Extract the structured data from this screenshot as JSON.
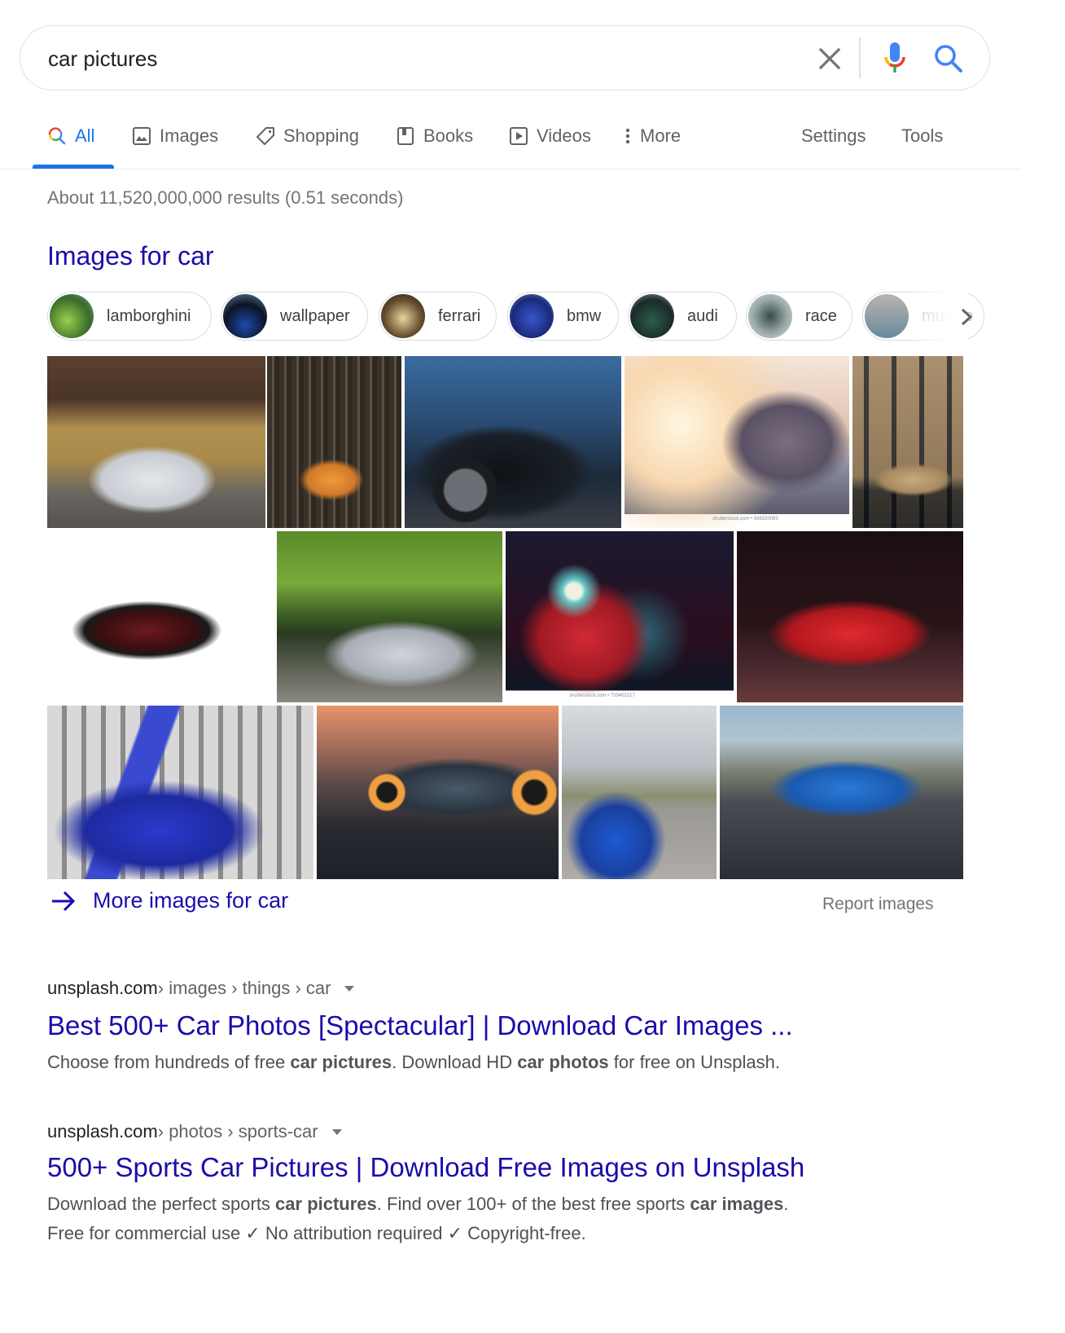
{
  "search": {
    "query": "car pictures",
    "clear_label": "Clear",
    "voice_label": "Search by voice",
    "search_label": "Search"
  },
  "tabs": [
    {
      "label": "All",
      "icon": "search-icon",
      "active": true
    },
    {
      "label": "Images",
      "icon": "image-icon"
    },
    {
      "label": "Shopping",
      "icon": "tag-icon"
    },
    {
      "label": "Books",
      "icon": "book-icon"
    },
    {
      "label": "Videos",
      "icon": "play-icon"
    },
    {
      "label": "More",
      "icon": "more-vert-icon"
    },
    {
      "label": "Settings"
    },
    {
      "label": "Tools"
    }
  ],
  "result_stats": "About 11,520,000,000 results (0.51 seconds)",
  "images_block": {
    "heading": "Images for car",
    "chips": [
      {
        "label": "lamborghini",
        "color": "#5d8a3a"
      },
      {
        "label": "wallpaper",
        "color": "#1a2a4a"
      },
      {
        "label": "ferrari",
        "color": "#6b5a3a"
      },
      {
        "label": "bmw",
        "color": "#2a3f9a"
      },
      {
        "label": "audi",
        "color": "#2d4d3a"
      },
      {
        "label": "race",
        "color": "#7a8a8a"
      },
      {
        "label": "muscle",
        "color": "#8a8a8a"
      }
    ],
    "thumbnails": [
      {
        "alt": "white McLaren by cabins"
      },
      {
        "alt": "orange Lamborghini in forest"
      },
      {
        "alt": "black car in city"
      },
      {
        "alt": "sports car near wind turbine",
        "watermark": "shutterstock.com • 566330083"
      },
      {
        "alt": "gold Lamborghini by building"
      },
      {
        "alt": "red and black Bugatti Veyron"
      },
      {
        "alt": "silver Mercedes-AMG GT"
      },
      {
        "alt": "red car headlight",
        "watermark": "shutterstock.com • 735402217"
      },
      {
        "alt": "red Corvette C8"
      },
      {
        "alt": "blue McLaren with doors open"
      },
      {
        "alt": "Lamborghini Terzo Millennio concept"
      },
      {
        "alt": "blue McLaren Senna"
      },
      {
        "alt": "blue Bugatti Chiron"
      }
    ],
    "more_label": "More images for car",
    "report_label": "Report images"
  },
  "results": [
    {
      "domain": "unsplash.com",
      "path": " › images › things › car",
      "title": "Best 500+ Car Photos [Spectacular] | Download Car Images ...",
      "snippet_parts": [
        {
          "t": "Choose from hundreds of free "
        },
        {
          "t": "car pictures",
          "b": true
        },
        {
          "t": ". Download HD "
        },
        {
          "t": "car photos",
          "b": true
        },
        {
          "t": " for free on Unsplash."
        }
      ]
    },
    {
      "domain": "unsplash.com",
      "path": " › photos › sports-car",
      "title": "500+ Sports Car Pictures | Download Free Images on Unsplash",
      "snippet_parts": [
        {
          "t": "Download the perfect sports "
        },
        {
          "t": "car pictures",
          "b": true
        },
        {
          "t": ". Find over 100+ of the best free sports "
        },
        {
          "t": "car images",
          "b": true
        },
        {
          "t": "."
        },
        {
          "br": true
        },
        {
          "t": "Free for commercial use ✓ No attribution required ✓ Copyright-free."
        }
      ]
    }
  ],
  "colors": {
    "link": "#1a0dab",
    "accent": "#1a73e8",
    "muted": "#70757a"
  }
}
